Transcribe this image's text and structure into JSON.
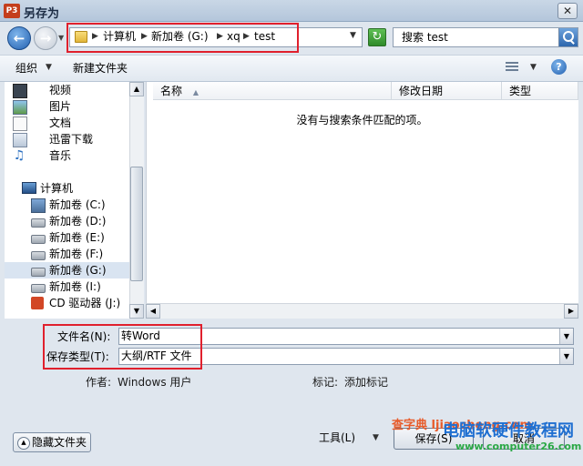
{
  "window": {
    "title": "另存为",
    "app_icon": "P3",
    "close_glyph": "✕"
  },
  "address": {
    "crumbs": [
      "计算机",
      "新加卷 (G:)",
      "xq",
      "test"
    ],
    "search_placeholder": "搜索 test"
  },
  "toolbar": {
    "organize": "组织",
    "new_folder": "新建文件夹",
    "help": "?"
  },
  "nav": {
    "libraries": [
      {
        "label": "视频",
        "icon": "video-icon"
      },
      {
        "label": "图片",
        "icon": "picture-icon"
      },
      {
        "label": "文档",
        "icon": "document-icon"
      },
      {
        "label": "迅雷下载",
        "icon": "download-icon"
      },
      {
        "label": "音乐",
        "icon": "music-icon"
      }
    ],
    "computer": "计算机",
    "drives": [
      {
        "label": "新加卷 (C:)"
      },
      {
        "label": "新加卷 (D:)"
      },
      {
        "label": "新加卷 (E:)"
      },
      {
        "label": "新加卷 (F:)"
      },
      {
        "label": "新加卷 (G:)"
      },
      {
        "label": "新加卷 (I:)"
      },
      {
        "label": "CD 驱动器 (J:)"
      }
    ],
    "selected": "新加卷 (G:)"
  },
  "columns": [
    "名称",
    "修改日期",
    "类型"
  ],
  "empty_message": "没有与搜索条件匹配的项。",
  "form": {
    "filename_label": "文件名(N):",
    "filename_value": "转Word",
    "filetype_label": "保存类型(T):",
    "filetype_value": "大纲/RTF 文件"
  },
  "meta": {
    "author_label": "作者:",
    "author_value": "Windows 用户",
    "tags_label": "标记:",
    "tags_value": "添加标记"
  },
  "footer": {
    "hide_folders": "隐藏文件夹",
    "tools": "工具(L)",
    "save": "保存(S)",
    "cancel": "取消"
  },
  "watermarks": {
    "site_name": "电脑软硬件教程网",
    "site_url": "www.computer26.com",
    "overlay": "查字典 ljiaocheng.com"
  },
  "colors": {
    "highlight": "#e0202d",
    "accent": "#2360b0"
  }
}
